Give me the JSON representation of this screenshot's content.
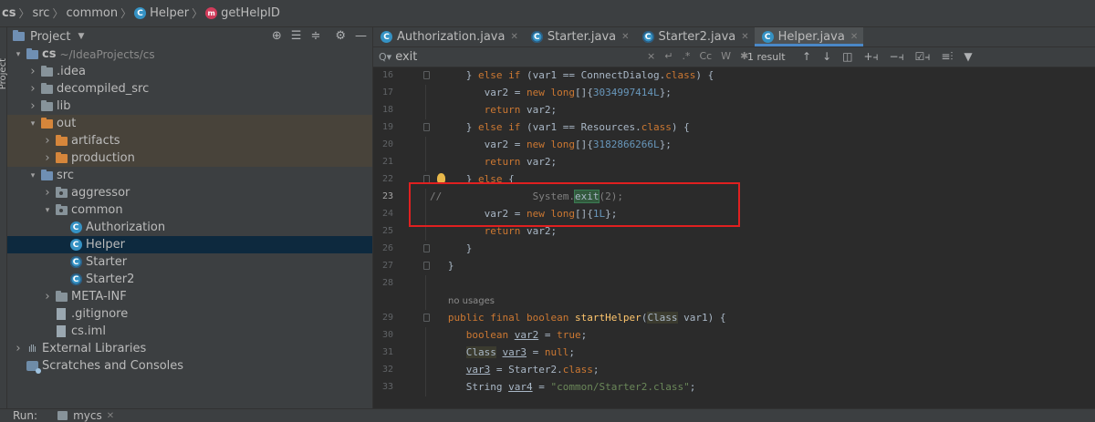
{
  "breadcrumb": {
    "items": [
      "cs",
      "src",
      "common",
      "Helper",
      "getHelpID"
    ]
  },
  "tool_stripe": {
    "label": "Project"
  },
  "project_panel": {
    "title": "Project",
    "tree": [
      {
        "label": "cs",
        "sub": "~/IdeaProjects/cs",
        "depth": 0,
        "expanded": true,
        "icon": "module-folder"
      },
      {
        "label": ".idea",
        "depth": 1,
        "expanded": false,
        "icon": "folder"
      },
      {
        "label": "decompiled_src",
        "depth": 1,
        "expanded": false,
        "icon": "folder"
      },
      {
        "label": "lib",
        "depth": 1,
        "expanded": false,
        "icon": "folder"
      },
      {
        "label": "out",
        "depth": 1,
        "expanded": true,
        "icon": "folder-orange",
        "excluded": true
      },
      {
        "label": "artifacts",
        "depth": 2,
        "expanded": false,
        "icon": "folder-orange",
        "excluded": true
      },
      {
        "label": "production",
        "depth": 2,
        "expanded": false,
        "icon": "folder-orange",
        "excluded": true
      },
      {
        "label": "src",
        "depth": 1,
        "expanded": true,
        "icon": "folder-blue"
      },
      {
        "label": "aggressor",
        "depth": 2,
        "expanded": false,
        "icon": "package"
      },
      {
        "label": "common",
        "depth": 2,
        "expanded": true,
        "icon": "package"
      },
      {
        "label": "Authorization",
        "depth": 3,
        "icon": "class"
      },
      {
        "label": "Helper",
        "depth": 3,
        "icon": "class",
        "selected": true
      },
      {
        "label": "Starter",
        "depth": 3,
        "icon": "class-ring"
      },
      {
        "label": "Starter2",
        "depth": 3,
        "icon": "class-ring"
      },
      {
        "label": "META-INF",
        "depth": 2,
        "expanded": false,
        "icon": "folder"
      },
      {
        "label": ".gitignore",
        "depth": 2,
        "icon": "file"
      },
      {
        "label": "cs.iml",
        "depth": 2,
        "icon": "file"
      },
      {
        "label": "External Libraries",
        "depth": 0,
        "expanded": false,
        "icon": "library"
      },
      {
        "label": "Scratches and Consoles",
        "depth": 0,
        "icon": "scratch"
      }
    ]
  },
  "tabs": [
    {
      "label": "Authorization.java",
      "active": false
    },
    {
      "label": "Starter.java",
      "active": false
    },
    {
      "label": "Starter2.java",
      "active": false
    },
    {
      "label": "Helper.java",
      "active": true
    }
  ],
  "find": {
    "query": "exit",
    "options": [
      "×",
      "↵",
      ".*",
      "Cc",
      "W",
      "✱"
    ],
    "result": "1 result"
  },
  "code_lines": [
    {
      "n": "16",
      "html": "      } <span class=\"kw\">else if</span> (var1 == ConnectDialog.<span class=\"kw\">class</span>) {"
    },
    {
      "n": "17",
      "html": "         var2 = <span class=\"kw\">new long</span>[]{<span class=\"num\">3034997414L</span>};"
    },
    {
      "n": "18",
      "html": "         <span class=\"kw\">return</span> var2;"
    },
    {
      "n": "19",
      "html": "      } <span class=\"kw\">else if</span> (var1 == Resources.<span class=\"kw\">class</span>) {"
    },
    {
      "n": "20",
      "html": "         var2 = <span class=\"kw\">new long</span>[]{<span class=\"num\">3182866266L</span>};"
    },
    {
      "n": "21",
      "html": "         <span class=\"kw\">return</span> var2;"
    },
    {
      "n": "22",
      "html": "      } <span class=\"kw\">else</span> {"
    },
    {
      "n": "23",
      "html": "<span class=\"cm\">//               System.</span><span class=\"hl\">exit</span><span class=\"cm\">(2);</span>"
    },
    {
      "n": "24",
      "html": "         var2 = <span class=\"kw\">new long</span>[]{<span class=\"num\">1L</span>};"
    },
    {
      "n": "25",
      "html": "         <span class=\"kw\">return</span> var2;"
    },
    {
      "n": "26",
      "html": "      }"
    },
    {
      "n": "27",
      "html": "   }"
    },
    {
      "n": "28",
      "html": ""
    },
    {
      "n": "",
      "usage": "no usages"
    },
    {
      "n": "29",
      "html": "   <span class=\"kw\">public final boolean</span> <span class=\"fn\">startHelper</span>(<span class=\"hl2\">Class</span> var1) {"
    },
    {
      "n": "30",
      "html": "      <span class=\"kw\">boolean</span> <u>var2</u> = <span class=\"kw\">true</span>;"
    },
    {
      "n": "31",
      "html": "      <span class=\"hl2\">Class</span> <u>var3</u> = <span class=\"kw\">null</span>;"
    },
    {
      "n": "32",
      "html": "      <u>var3</u> = Starter2.<span class=\"kw\">class</span>;"
    },
    {
      "n": "33",
      "html": "      String <u>var4</u> = <span class=\"str\">\"common/Starter2.class\"</span>;"
    }
  ],
  "run_bar": {
    "label": "Run:",
    "tab": "mycs"
  }
}
